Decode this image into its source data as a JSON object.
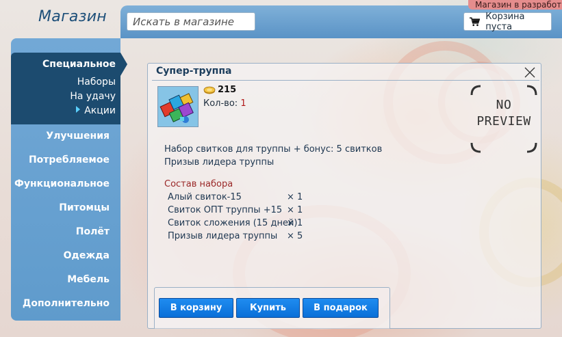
{
  "header": {
    "logo": "Магазин",
    "search_placeholder": "Искать в магазине",
    "cart_label": "Корзина пуста",
    "dev_badge": "Магазин в разработке"
  },
  "sidebar": {
    "special": {
      "label": "Специальное",
      "subitems": [
        {
          "label": "Наборы",
          "active": false
        },
        {
          "label": "На удачу",
          "active": false
        },
        {
          "label": "Акции",
          "active": true
        }
      ]
    },
    "items": [
      {
        "label": "Улучшения"
      },
      {
        "label": "Потребляемое"
      },
      {
        "label": "Функциональное"
      },
      {
        "label": "Питомцы"
      },
      {
        "label": "Полёт"
      },
      {
        "label": "Одежда"
      },
      {
        "label": "Мебель"
      },
      {
        "label": "Дополнительно"
      }
    ]
  },
  "product": {
    "title": "Супер-труппа",
    "price": "215",
    "qty_label": "Кол-во: ",
    "qty_value": "1",
    "preview_line1": "NO",
    "preview_line2": "PREVIEW",
    "description": [
      "Набор свитков для труппы + бонус: 5 свитков",
      "Призыв лидера труппы"
    ],
    "set_title": "Состав набора",
    "set_items": [
      {
        "name": "Алый свиток-15",
        "qty": "× 1"
      },
      {
        "name": "Свиток ОПТ труппы +15",
        "qty": "× 1"
      },
      {
        "name": "Свиток сложения (15 дней)",
        "qty": "× 1"
      },
      {
        "name": "Призыв лидера труппы",
        "qty": "× 5"
      }
    ]
  },
  "actions": {
    "to_cart": "В корзину",
    "buy": "Купить",
    "gift": "В подарок"
  },
  "colors": {
    "accent_blue": "#0a6fd8",
    "sidebar_blue": "#5f9bcc",
    "sidebar_active": "#1c4b6f",
    "qty_red": "#b01818"
  }
}
